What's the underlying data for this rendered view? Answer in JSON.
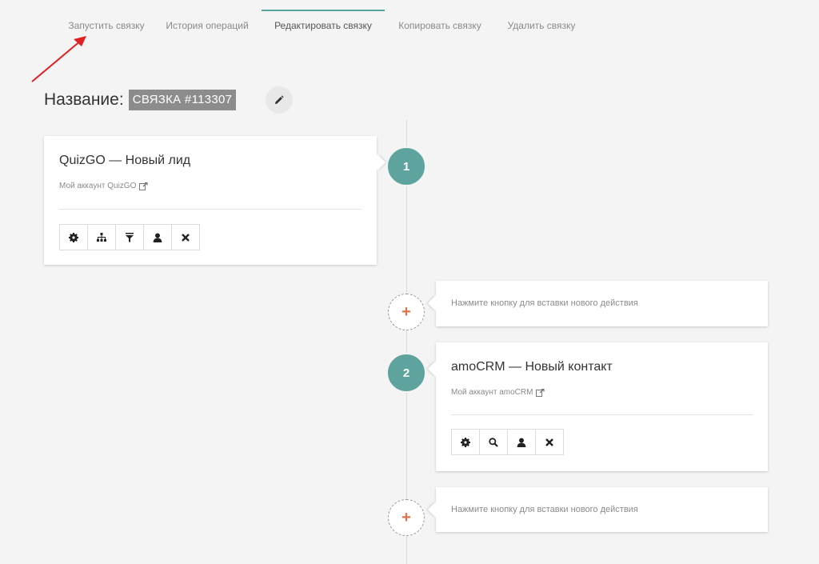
{
  "tabs": [
    {
      "label": "Запустить связку"
    },
    {
      "label": "История операций"
    },
    {
      "label": "Редактировать связку"
    },
    {
      "label": "Копировать связку"
    },
    {
      "label": "Удалить связку"
    }
  ],
  "header": {
    "label": "Название:",
    "name": "СВЯЗКА #113307"
  },
  "steps": [
    {
      "number": "1",
      "title": "QuizGO — Новый лид",
      "account": "Мой аккаунт QuizGO",
      "tools": [
        "gear-icon",
        "sitemap-icon",
        "filter-icon",
        "user-icon",
        "close-icon"
      ]
    },
    {
      "number": "2",
      "title": "amoCRM — Новый контакт",
      "account": "Мой аккаунт amoCRM",
      "tools": [
        "gear-icon",
        "search-icon",
        "user-icon",
        "close-icon"
      ]
    }
  ],
  "insert": {
    "text": "Нажмите кнопку для вставки нового действия",
    "plus": "+"
  },
  "colors": {
    "accent": "#5fa39e",
    "plus": "#e2714a",
    "badge": "#8c8c8c",
    "arrow": "#e02020"
  }
}
